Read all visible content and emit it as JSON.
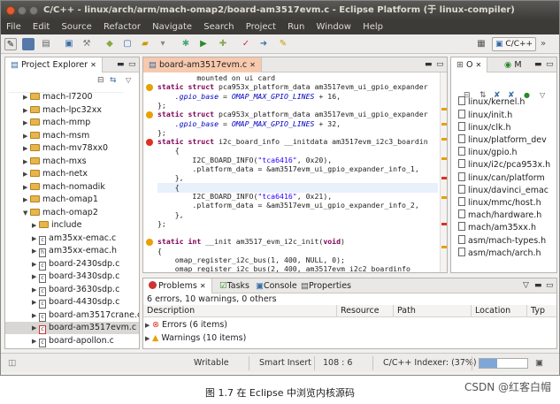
{
  "window": {
    "title": "C/C++ - linux/arch/arm/mach-omap2/board-am3517evm.c - Eclipse Platform (于 linux-compiler)"
  },
  "menu": [
    "File",
    "Edit",
    "Source",
    "Refactor",
    "Navigate",
    "Search",
    "Project",
    "Run",
    "Window",
    "Help"
  ],
  "toolbar": {
    "perspective_label": "C/C++"
  },
  "project_explorer": {
    "tab_label": "Project Explorer",
    "items": [
      {
        "label": "mach-l7200",
        "kind": "folder",
        "level": 1,
        "expanded": false
      },
      {
        "label": "mach-lpc32xx",
        "kind": "folder",
        "level": 1,
        "expanded": false
      },
      {
        "label": "mach-mmp",
        "kind": "folder",
        "level": 1,
        "expanded": false
      },
      {
        "label": "mach-msm",
        "kind": "folder",
        "level": 1,
        "expanded": false
      },
      {
        "label": "mach-mv78xx0",
        "kind": "folder",
        "level": 1,
        "expanded": false
      },
      {
        "label": "mach-mxs",
        "kind": "folder",
        "level": 1,
        "expanded": false
      },
      {
        "label": "mach-netx",
        "kind": "folder",
        "level": 1,
        "expanded": false
      },
      {
        "label": "mach-nomadik",
        "kind": "folder",
        "level": 1,
        "expanded": false
      },
      {
        "label": "mach-omap1",
        "kind": "folder",
        "level": 1,
        "expanded": false
      },
      {
        "label": "mach-omap2",
        "kind": "folder",
        "level": 1,
        "expanded": true
      },
      {
        "label": "include",
        "kind": "folder",
        "level": 2,
        "expanded": false
      },
      {
        "label": "am35xx-emac.c",
        "kind": "c",
        "level": 2
      },
      {
        "label": "am35xx-emac.h",
        "kind": "h",
        "level": 2
      },
      {
        "label": "board-2430sdp.c",
        "kind": "c",
        "level": 2
      },
      {
        "label": "board-3430sdp.c",
        "kind": "c",
        "level": 2
      },
      {
        "label": "board-3630sdp.c",
        "kind": "c",
        "level": 2
      },
      {
        "label": "board-4430sdp.c",
        "kind": "c",
        "level": 2
      },
      {
        "label": "board-am3517crane.c",
        "kind": "c",
        "level": 2
      },
      {
        "label": "board-am3517evm.c",
        "kind": "c",
        "level": 2,
        "selected": true
      },
      {
        "label": "board-apollon.c",
        "kind": "c",
        "level": 2
      }
    ]
  },
  "editor": {
    "tab_label": "board-am3517evm.c",
    "lines": [
      [
        {
          "t": "         ",
          "c": ""
        },
        {
          "t": "mounted on ui card",
          "c": ""
        }
      ],
      [
        {
          "t": "static struct ",
          "c": "kw"
        },
        {
          "t": "pca953x_platform_data am3517evm_ui_gpio_expander",
          "c": ""
        }
      ],
      [
        {
          "t": "    .gpio_base",
          "c": "mac"
        },
        {
          "t": " = ",
          "c": ""
        },
        {
          "t": "OMAP_MAX_GPIO_LINES",
          "c": "mac"
        },
        {
          "t": " + 16,",
          "c": ""
        }
      ],
      [
        {
          "t": "};",
          "c": ""
        }
      ],
      [
        {
          "t": "static struct ",
          "c": "kw"
        },
        {
          "t": "pca953x_platform_data am3517evm_ui_gpio_expander",
          "c": ""
        }
      ],
      [
        {
          "t": "    .gpio_base",
          "c": "mac"
        },
        {
          "t": " = ",
          "c": ""
        },
        {
          "t": "OMAP_MAX_GPIO_LINES",
          "c": "mac"
        },
        {
          "t": " + 32,",
          "c": ""
        }
      ],
      [
        {
          "t": "};",
          "c": ""
        }
      ],
      [
        {
          "t": "static struct ",
          "c": "kw"
        },
        {
          "t": "i2c_board_info __initdata am3517evm_i2c3_boardin",
          "c": ""
        }
      ],
      [
        {
          "t": "    {",
          "c": ""
        }
      ],
      [
        {
          "t": "        I2C_BOARD_INFO(",
          "c": ""
        },
        {
          "t": "\"tca6416\"",
          "c": "str"
        },
        {
          "t": ", 0x20),",
          "c": ""
        }
      ],
      [
        {
          "t": "        .platform_data = &am3517evm_ui_gpio_expander_info_1,",
          "c": ""
        }
      ],
      [
        {
          "t": "    },",
          "c": ""
        }
      ],
      [
        {
          "t": "    {",
          "c": ""
        }
      ],
      [
        {
          "t": "        I2C_BOARD_INFO(",
          "c": ""
        },
        {
          "t": "\"tca6416\"",
          "c": "str"
        },
        {
          "t": ", 0x21),",
          "c": ""
        }
      ],
      [
        {
          "t": "        .platform_data = &am3517evm_ui_gpio_expander_info_2,",
          "c": ""
        }
      ],
      [
        {
          "t": "    },",
          "c": ""
        }
      ],
      [
        {
          "t": "};",
          "c": ""
        }
      ],
      [
        {
          "t": "",
          "c": ""
        }
      ],
      [
        {
          "t": "static int ",
          "c": "kw"
        },
        {
          "t": "__init am3517_evm_i2c_init(",
          "c": ""
        },
        {
          "t": "void",
          "c": "kw"
        },
        {
          "t": ")",
          "c": ""
        }
      ],
      [
        {
          "t": "{",
          "c": ""
        }
      ],
      [
        {
          "t": "    omap_register_i2c_bus(1, 400, NULL, 0);",
          "c": ""
        }
      ],
      [
        {
          "t": "    omap_register_i2c_bus(2, 400, am3517evm_i2c2_boardinfo",
          "c": ""
        }
      ]
    ]
  },
  "outline": {
    "tab_o": "O",
    "tab_m": "M",
    "items": [
      "asm/mach/arch.h",
      "asm/mach-types.h",
      "mach/am35xx.h",
      "mach/hardware.h",
      "linux/mmc/host.h",
      "linux/davinci_emac",
      "linux/can/platform",
      "linux/i2c/pca953x.h",
      "linux/gpio.h",
      "linux/platform_dev",
      "linux/clk.h",
      "linux/init.h",
      "linux/kernel.h"
    ]
  },
  "problems": {
    "tabs": [
      "Problems",
      "Tasks",
      "Console",
      "Properties"
    ],
    "summary": "6 errors, 10 warnings, 0 others",
    "columns": [
      "Description",
      "Resource",
      "Path",
      "Location",
      "Typ"
    ],
    "rows": [
      {
        "label": "Errors (6 items)",
        "kind": "error"
      },
      {
        "label": "Warnings (10 items)",
        "kind": "warning"
      }
    ]
  },
  "status": {
    "mode": "Writable",
    "insert": "Smart Insert",
    "position": "108 : 6",
    "indexer": "C/C++ Indexer: (37%)"
  },
  "caption": "图 1.7 在 Eclipse 中浏览内核源码",
  "watermark": "CSDN @红客白帽",
  "colors": {
    "title_bg": "#3c3b37",
    "editor_tab": "#f7c9ae",
    "keyword": "#7f0055",
    "string": "#2a00ff",
    "error": "#e03020",
    "warning": "#e8a000"
  }
}
